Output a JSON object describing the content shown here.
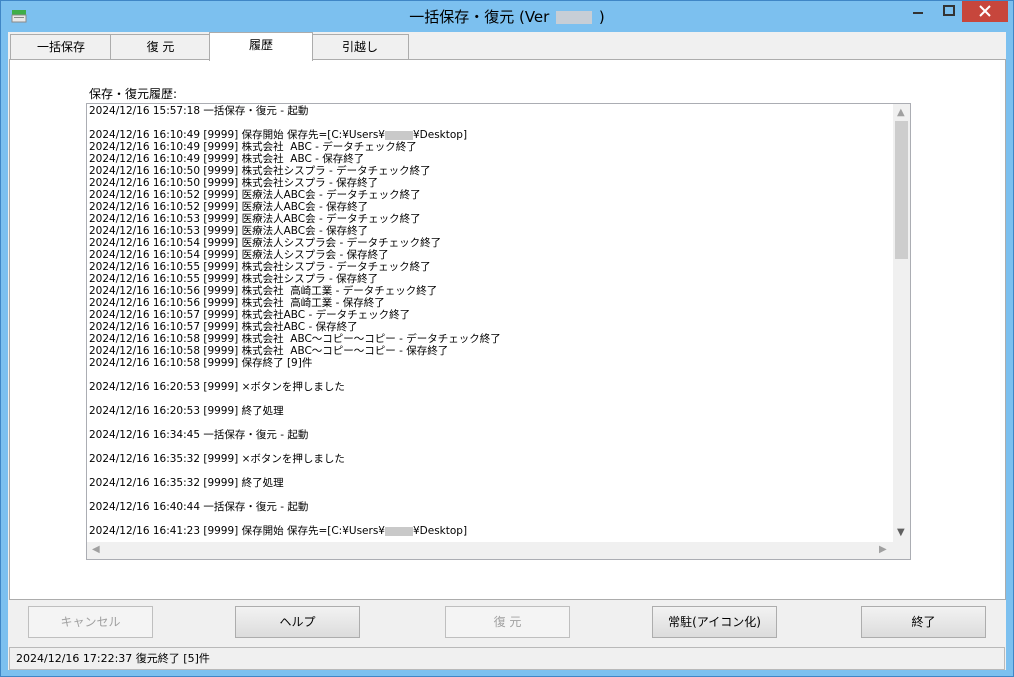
{
  "window": {
    "title_prefix": "一括保存・復元 (Ver",
    "title_suffix": ")"
  },
  "tabs": [
    {
      "label": "一括保存"
    },
    {
      "label": "復 元"
    },
    {
      "label": "履歴"
    },
    {
      "label": "引越し"
    }
  ],
  "history": {
    "label": "保存・復元履歴:",
    "log": [
      "2024/12/16 15:57:18 一括保存・復元 - 起動",
      "",
      "2024/12/16 16:10:49 [9999] 保存開始 保存先=[C:¥Users¥@@¥Desktop]",
      "2024/12/16 16:10:49 [9999] 株式会社  ABC - データチェック終了",
      "2024/12/16 16:10:49 [9999] 株式会社  ABC - 保存終了",
      "2024/12/16 16:10:50 [9999] 株式会社シスプラ - データチェック終了",
      "2024/12/16 16:10:50 [9999] 株式会社シスプラ - 保存終了",
      "2024/12/16 16:10:52 [9999] 医療法人ABC会 - データチェック終了",
      "2024/12/16 16:10:52 [9999] 医療法人ABC会 - 保存終了",
      "2024/12/16 16:10:53 [9999] 医療法人ABC会 - データチェック終了",
      "2024/12/16 16:10:53 [9999] 医療法人ABC会 - 保存終了",
      "2024/12/16 16:10:54 [9999] 医療法人シスプラ会 - データチェック終了",
      "2024/12/16 16:10:54 [9999] 医療法人シスプラ会 - 保存終了",
      "2024/12/16 16:10:55 [9999] 株式会社シスプラ - データチェック終了",
      "2024/12/16 16:10:55 [9999] 株式会社シスプラ - 保存終了",
      "2024/12/16 16:10:56 [9999] 株式会社  高崎工業 - データチェック終了",
      "2024/12/16 16:10:56 [9999] 株式会社  高崎工業 - 保存終了",
      "2024/12/16 16:10:57 [9999] 株式会社ABC - データチェック終了",
      "2024/12/16 16:10:57 [9999] 株式会社ABC - 保存終了",
      "2024/12/16 16:10:58 [9999] 株式会社  ABC～コピー～コピー - データチェック終了",
      "2024/12/16 16:10:58 [9999] 株式会社  ABC～コピー～コピー - 保存終了",
      "2024/12/16 16:10:58 [9999] 保存終了 [9]件",
      "",
      "2024/12/16 16:20:53 [9999] ×ボタンを押しました",
      "",
      "2024/12/16 16:20:53 [9999] 終了処理",
      "",
      "2024/12/16 16:34:45 一括保存・復元 - 起動",
      "",
      "2024/12/16 16:35:32 [9999] ×ボタンを押しました",
      "",
      "2024/12/16 16:35:32 [9999] 終了処理",
      "",
      "2024/12/16 16:40:44 一括保存・復元 - 起動",
      "",
      "2024/12/16 16:41:23 [9999] 保存開始 保存先=[C:¥Users¥@@¥Desktop]"
    ]
  },
  "buttons": {
    "cancel": "キャンセル",
    "help": "ヘルプ",
    "restore": "復 元",
    "resident": "常駐(アイコン化)",
    "exit": "終了"
  },
  "status": {
    "text": "2024/12/16 17:22:37 復元終了 [5]件"
  }
}
